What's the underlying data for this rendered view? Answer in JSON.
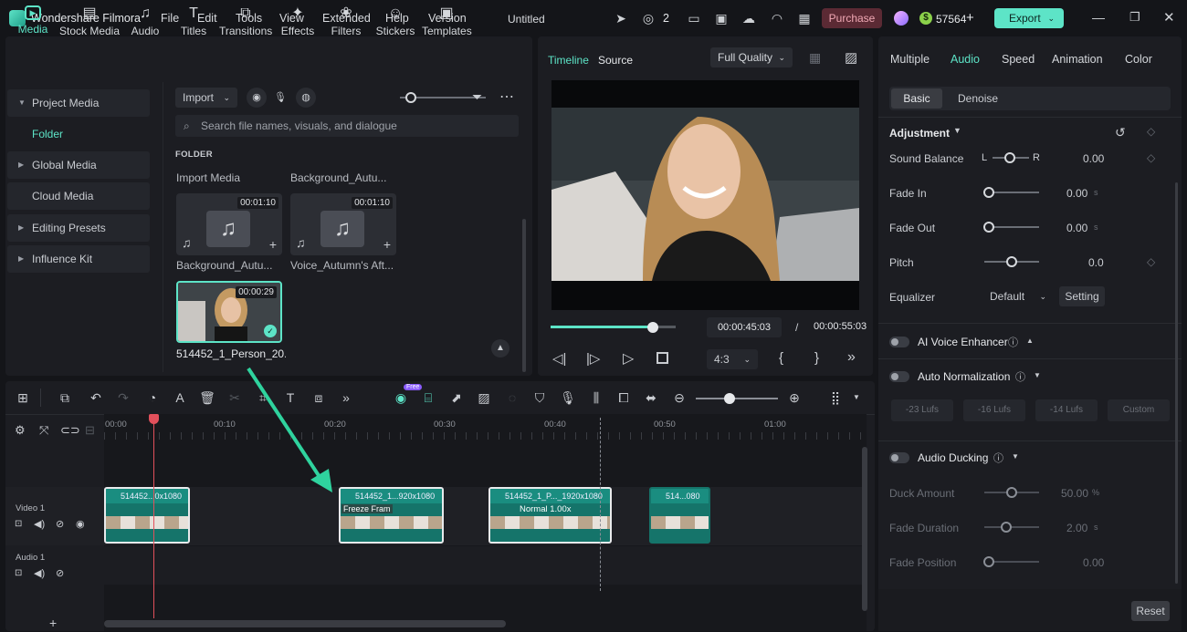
{
  "titlebar": {
    "app_name": "Wondershare Filmora",
    "menu": [
      "File",
      "Edit",
      "Tools",
      "View",
      "Extended",
      "Help",
      "Version"
    ],
    "doc_title": "Untitled",
    "devices_count": "2",
    "purchase": "Purchase",
    "coins": "57564",
    "export": "Export"
  },
  "media": {
    "tabs": [
      "Media",
      "Stock Media",
      "Audio",
      "Titles",
      "Transitions",
      "Effects",
      "Filters",
      "Stickers",
      "Templates"
    ],
    "sidebar": [
      "Project Media",
      "Folder",
      "Global Media",
      "Cloud Media",
      "Editing Presets",
      "Influence Kit"
    ],
    "import_label": "Import",
    "search_placeholder": "Search file names, visuals, and dialogue",
    "section_label": "FOLDER",
    "import_media_label": "Import Media",
    "items": [
      {
        "name": "Background_Autu...",
        "duration": "00:01:10"
      },
      {
        "name": "Voice_Autumn's Aft...",
        "duration": "00:01:10"
      },
      {
        "name": "514452_1_Person_20...",
        "duration": "00:00:29"
      }
    ],
    "header_item2_name": "Background_Autu..."
  },
  "preview": {
    "tab_timeline": "Timeline",
    "tab_source": "Source",
    "quality": "Full Quality",
    "current_time": "00:00:45:03",
    "separator": "/",
    "total_time": "00:00:55:03",
    "ratio": "4:3",
    "progress": 0.82
  },
  "props": {
    "tabs": [
      "Multiple",
      "Audio",
      "Speed",
      "Animation",
      "Color"
    ],
    "subtabs": [
      "Basic",
      "Denoise"
    ],
    "adjustment": "Adjustment",
    "rows": [
      {
        "label": "Sound Balance",
        "value": "0.00",
        "l": "L",
        "r": "R",
        "pos": 0.5
      },
      {
        "label": "Fade In",
        "value": "0.00",
        "unit": "s",
        "pos": 0
      },
      {
        "label": "Fade Out",
        "value": "0.00",
        "unit": "s",
        "pos": 0
      },
      {
        "label": "Pitch",
        "value": "0.0",
        "pos": 0.5
      }
    ],
    "equalizer_label": "Equalizer",
    "equalizer_value": "Default",
    "setting": "Setting",
    "ai_voice": "AI Voice Enhancer",
    "auto_norm": "Auto Normalization",
    "lufs": [
      "-23 Lufs",
      "-16 Lufs",
      "-14 Lufs",
      "Custom"
    ],
    "ducking": "Audio Ducking",
    "duck_rows": [
      {
        "label": "Duck Amount",
        "value": "50.00",
        "unit": "%",
        "pos": 0.5
      },
      {
        "label": "Fade Duration",
        "value": "2.00",
        "unit": "s",
        "pos": 0.4
      },
      {
        "label": "Fade Position",
        "value": "0.00",
        "unit": "",
        "pos": 0
      }
    ],
    "reset": "Reset"
  },
  "timeline": {
    "ruler": [
      "00:00",
      "00:10",
      "00:20",
      "00:30",
      "00:40",
      "00:50",
      "01:00"
    ],
    "video_track": "Video 1",
    "audio_track": "Audio 1",
    "clips": [
      {
        "title": "514452...0x1080",
        "badge": ""
      },
      {
        "title": "514452_1...920x1080",
        "badge": "Freeze Fram"
      },
      {
        "title": "514452_1_P..._1920x1080",
        "badge": "Normal 1.00x"
      },
      {
        "title": "514...080",
        "badge": ""
      }
    ],
    "free_badge": "Free"
  },
  "colors": {
    "accent": "#5de4c7",
    "purchase_bg": "#5b2a34",
    "playhead": "#e2505b"
  }
}
